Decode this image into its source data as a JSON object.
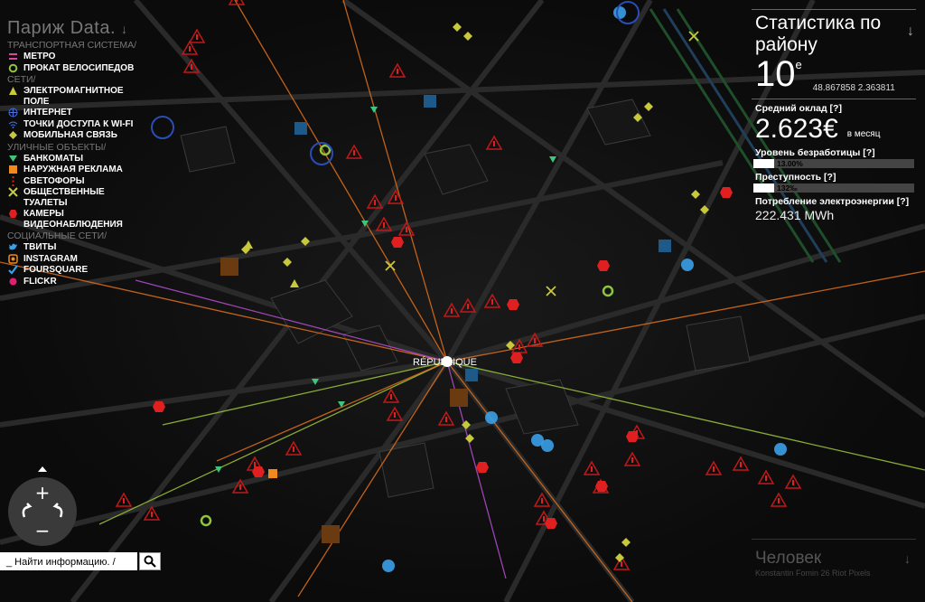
{
  "legend": {
    "title": "Париж Data.",
    "title_arrow": "↓",
    "groups": [
      {
        "label": "ТРАНСПОРТНАЯ СИСТЕМА/",
        "items": [
          {
            "label": "МЕТРО",
            "icon": "metro-icon",
            "color": "#d04b9c"
          },
          {
            "label": "ПРОКАТ ВЕЛОСИПЕДОВ",
            "icon": "bike-rental-icon",
            "color": "#8fc43b"
          }
        ]
      },
      {
        "label": "СЕТИ/",
        "items": [
          {
            "label": "ЭЛЕКТРОМАГНИТНОЕ ПОЛЕ",
            "icon": "emf-triangle-icon",
            "color": "#c8c83c"
          },
          {
            "label": "ИНТЕРНЕТ",
            "icon": "internet-icon",
            "color": "#4a6fd6"
          },
          {
            "label": "ТОЧКИ ДОСТУПА К WI-FI",
            "icon": "wifi-icon",
            "color": "#4a6fd6"
          },
          {
            "label": "МОБИЛЬНАЯ СВЯЗЬ",
            "icon": "mobile-diamond-icon",
            "color": "#c8c83c"
          }
        ]
      },
      {
        "label": "УЛИЧНЫЕ ОБЪЕКТЫ/",
        "items": [
          {
            "label": "БАНКОМАТЫ",
            "icon": "atm-icon",
            "color": "#3ec77a"
          },
          {
            "label": "НАРУЖНАЯ РЕКЛАМА",
            "icon": "billboard-icon",
            "color": "#f08a1c"
          },
          {
            "label": "СВЕТОФОРЫ",
            "icon": "traffic-light-icon",
            "color": "#e02020"
          },
          {
            "label": "ОБЩЕСТВЕННЫЕ ТУАЛЕТЫ",
            "icon": "toilet-icon",
            "color": "#c8c83c"
          },
          {
            "label": "КАМЕРЫ ВИДЕОНАБЛЮДЕНИЯ",
            "icon": "camera-icon",
            "color": "#e02020"
          }
        ]
      },
      {
        "label": "СОЦИАЛЬНЫЕ СЕТИ/",
        "items": [
          {
            "label": "ТВИТЫ",
            "icon": "twitter-icon",
            "color": "#3aa0e8"
          },
          {
            "label": "INSTAGRAM",
            "icon": "instagram-icon",
            "color": "#f08a1c"
          },
          {
            "label": "FOURSQUARE",
            "icon": "foursquare-icon",
            "color": "#3aa0e8"
          },
          {
            "label": "FLICKR",
            "icon": "flickr-icon",
            "color": "#e0206e"
          }
        ]
      }
    ]
  },
  "stats": {
    "title": "Статистика по району",
    "arrow": "↓",
    "district_number": "10",
    "district_suffix": "е",
    "coords": "48.867858 2.363811",
    "salary_label": "Средний оклад [?]",
    "salary_value": "2.623€",
    "salary_unit": "в месяц",
    "unemployment_label": "Уровень безработицы [?]",
    "unemployment_text": "13.00%",
    "unemployment_fraction": 0.13,
    "crime_label": "Преступность [?]",
    "crime_text": "132‰",
    "crime_fraction": 0.13,
    "energy_label": "Потребление электроэнергии [?]",
    "energy_value": "222.431 MWh"
  },
  "human": {
    "title": "Человек",
    "subtitle": "Konstantin Fomin 26 Riot Pixels",
    "arrow": "↓"
  },
  "map": {
    "place_label": "RÉPUBLIQUE"
  },
  "search": {
    "value": "_ Найти информацию. /",
    "button_icon": "search-icon"
  },
  "navigation": {
    "up_icon": "chevron-up-icon",
    "zoom_in": "+",
    "zoom_out": "−",
    "rotate_left_icon": "rotate-left-icon",
    "rotate_right_icon": "rotate-right-icon"
  },
  "colors": {
    "accent_red": "#e02020",
    "orange_line": "#e0701c",
    "purple_line": "#b44fd0",
    "green_line": "#9fc83a",
    "background": "#0b0b0b"
  }
}
